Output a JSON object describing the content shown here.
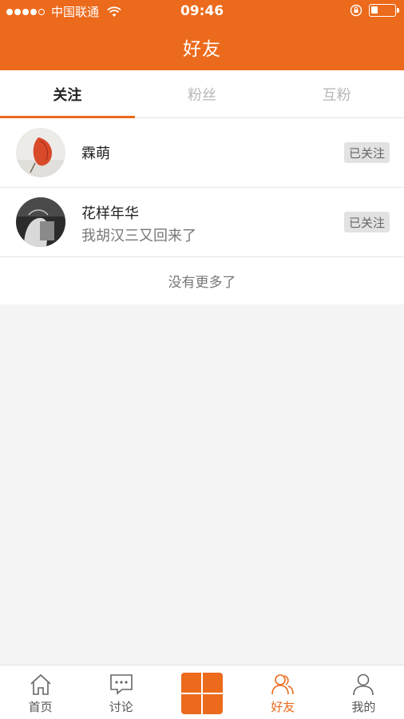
{
  "status_bar": {
    "carrier": "中国联通",
    "time": "09:46",
    "battery_level": 0.3
  },
  "header": {
    "title": "好友"
  },
  "tabs": [
    {
      "label": "关注",
      "active": true
    },
    {
      "label": "粉丝",
      "active": false
    },
    {
      "label": "互粉",
      "active": false
    }
  ],
  "list": {
    "items": [
      {
        "name": "霖萌",
        "subtitle": "",
        "button_label": "已关注"
      },
      {
        "name": "花样年华",
        "subtitle": "我胡汉三又回来了",
        "button_label": "已关注"
      }
    ],
    "end_text": "没有更多了"
  },
  "tabbar": {
    "items": [
      {
        "label": "首页",
        "icon": "home-icon",
        "active": false
      },
      {
        "label": "讨论",
        "icon": "chat-icon",
        "active": false
      },
      {
        "label": "",
        "icon": "grid-add-icon",
        "active": false
      },
      {
        "label": "好友",
        "icon": "friends-icon",
        "active": true
      },
      {
        "label": "我的",
        "icon": "person-icon",
        "active": false
      }
    ]
  },
  "colors": {
    "accent": "#ec6a1c",
    "background": "#f4f4f4"
  }
}
